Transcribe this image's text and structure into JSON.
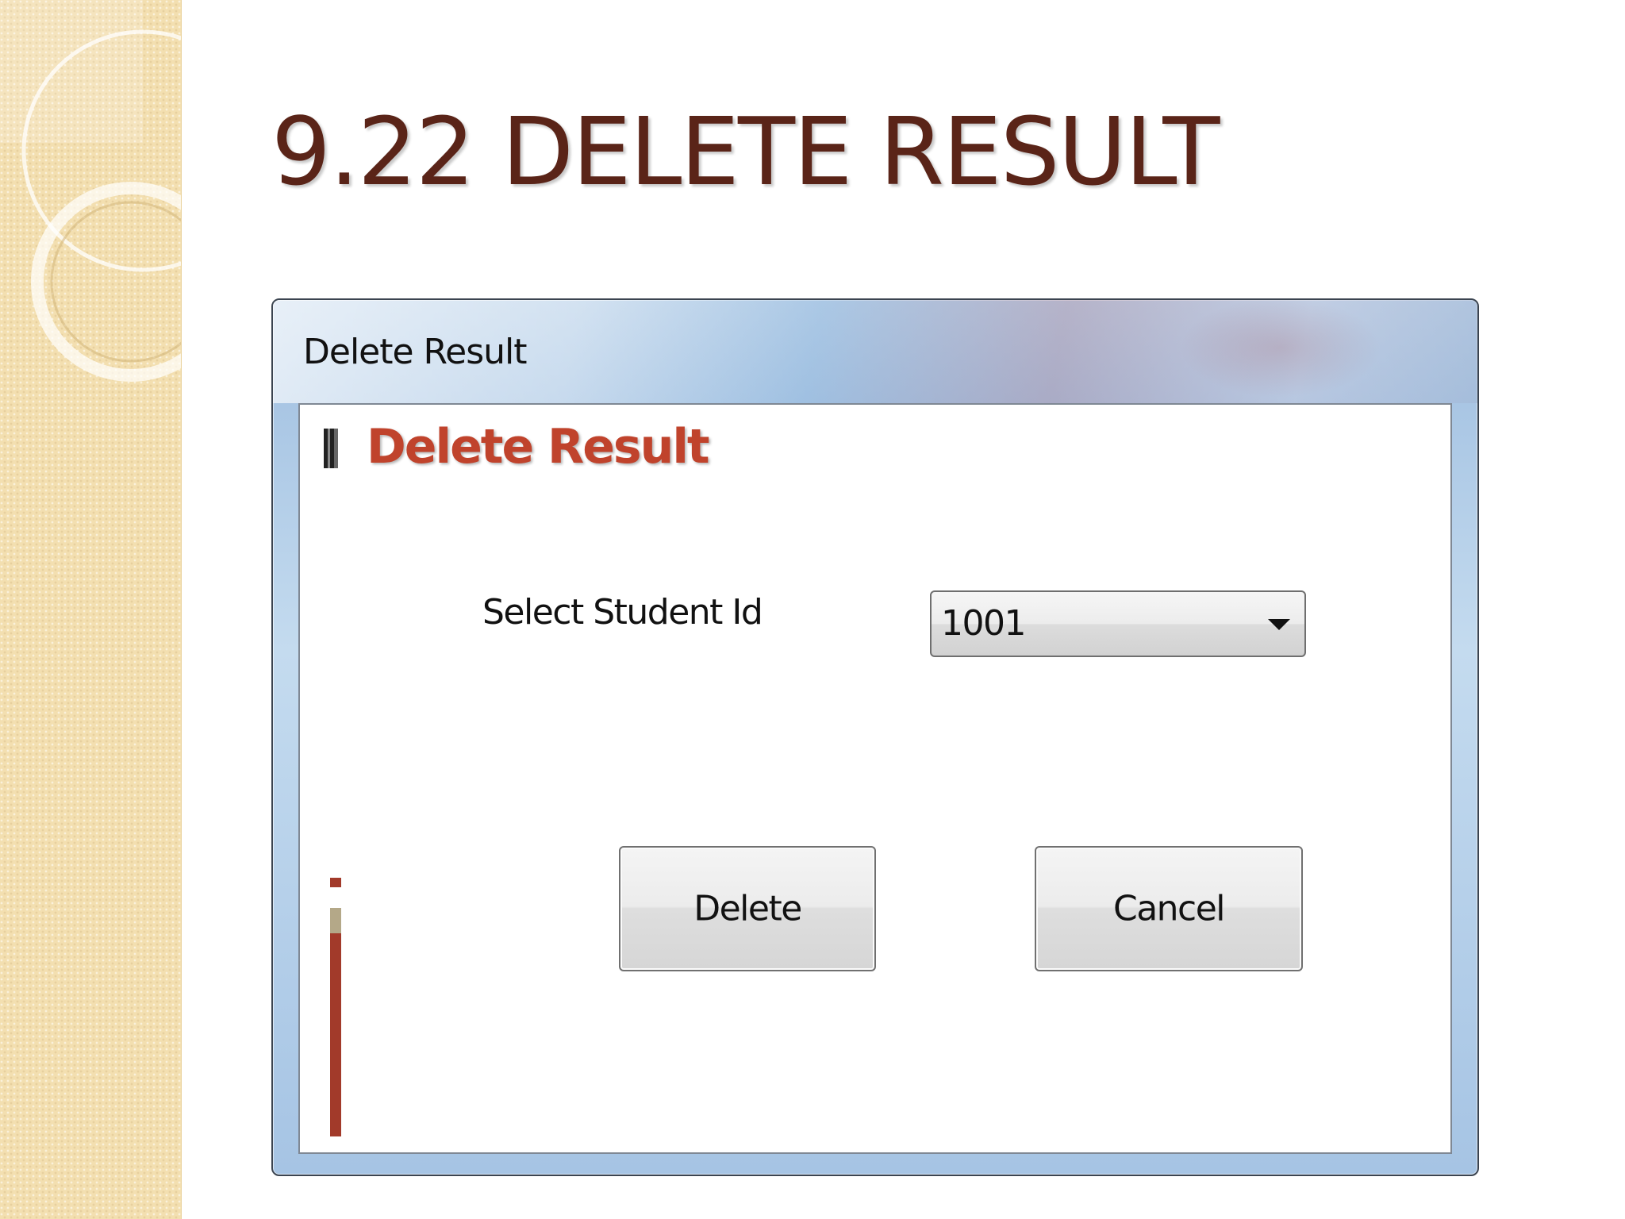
{
  "slide": {
    "title": "9.22 DELETE RESULT"
  },
  "dialog": {
    "window_title": "Delete Result",
    "header": "Delete Result",
    "student_id_label": "Select Student Id",
    "student_id_selected": "1001",
    "delete_label": "Delete",
    "cancel_label": "Cancel"
  },
  "colors": {
    "title": "#5a2418",
    "header_accent": "#c0432c",
    "left_strip": "#f3dfb0"
  },
  "icons": {
    "combo_arrow": "chevron-down-icon"
  }
}
